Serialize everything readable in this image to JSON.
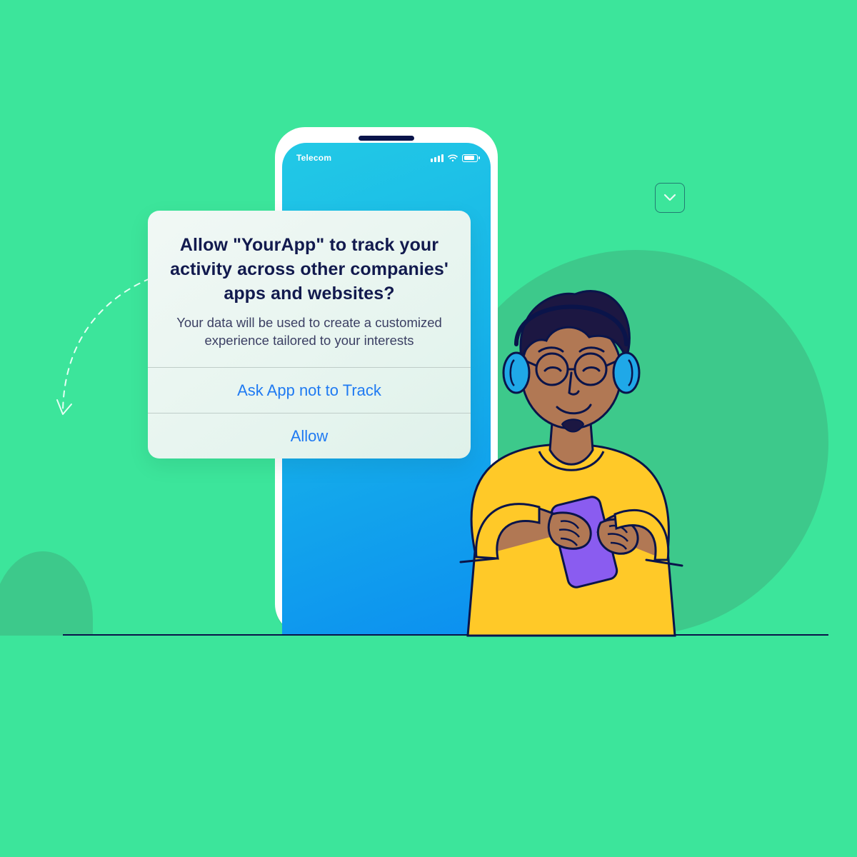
{
  "statusbar": {
    "carrier": "Telecom"
  },
  "permission_dialog": {
    "title": "Allow \"YourApp\" to track your activity across other companies' apps and websites?",
    "subtitle": "Your data will be used to create a customized experience tailored to your interests",
    "actions": {
      "deny": "Ask App not to Track",
      "allow": "Allow"
    }
  }
}
